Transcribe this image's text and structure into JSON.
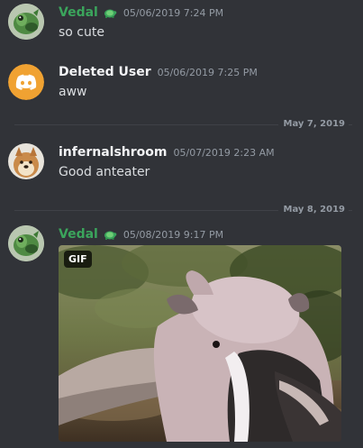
{
  "colors": {
    "background": "#313338",
    "vedal_name": "#3ba55c",
    "default_name": "#f2f3f5",
    "timestamp": "#949ba4",
    "text": "#dbdee1",
    "discord_orange": "#f0a232"
  },
  "messages": [
    {
      "author": "Vedal",
      "timestamp": "05/06/2019 7:24 PM",
      "text": "so cute",
      "avatar_icon": "green-fish-avatar",
      "badge_icon": "turtle-icon"
    },
    {
      "author": "Deleted User",
      "timestamp": "05/06/2019 7:25 PM",
      "text": "aww",
      "avatar_icon": "discord-logo-avatar"
    },
    {
      "author": "infernalshroom",
      "timestamp": "05/07/2019 2:23 AM",
      "text": "Good anteater",
      "avatar_icon": "doge-avatar"
    },
    {
      "author": "Vedal",
      "timestamp": "05/08/2019 9:17 PM",
      "avatar_icon": "green-fish-avatar",
      "badge_icon": "turtle-icon",
      "attachment_label": "GIF"
    }
  ],
  "dividers": [
    {
      "label": "May 7, 2019"
    },
    {
      "label": "May 8, 2019"
    }
  ]
}
